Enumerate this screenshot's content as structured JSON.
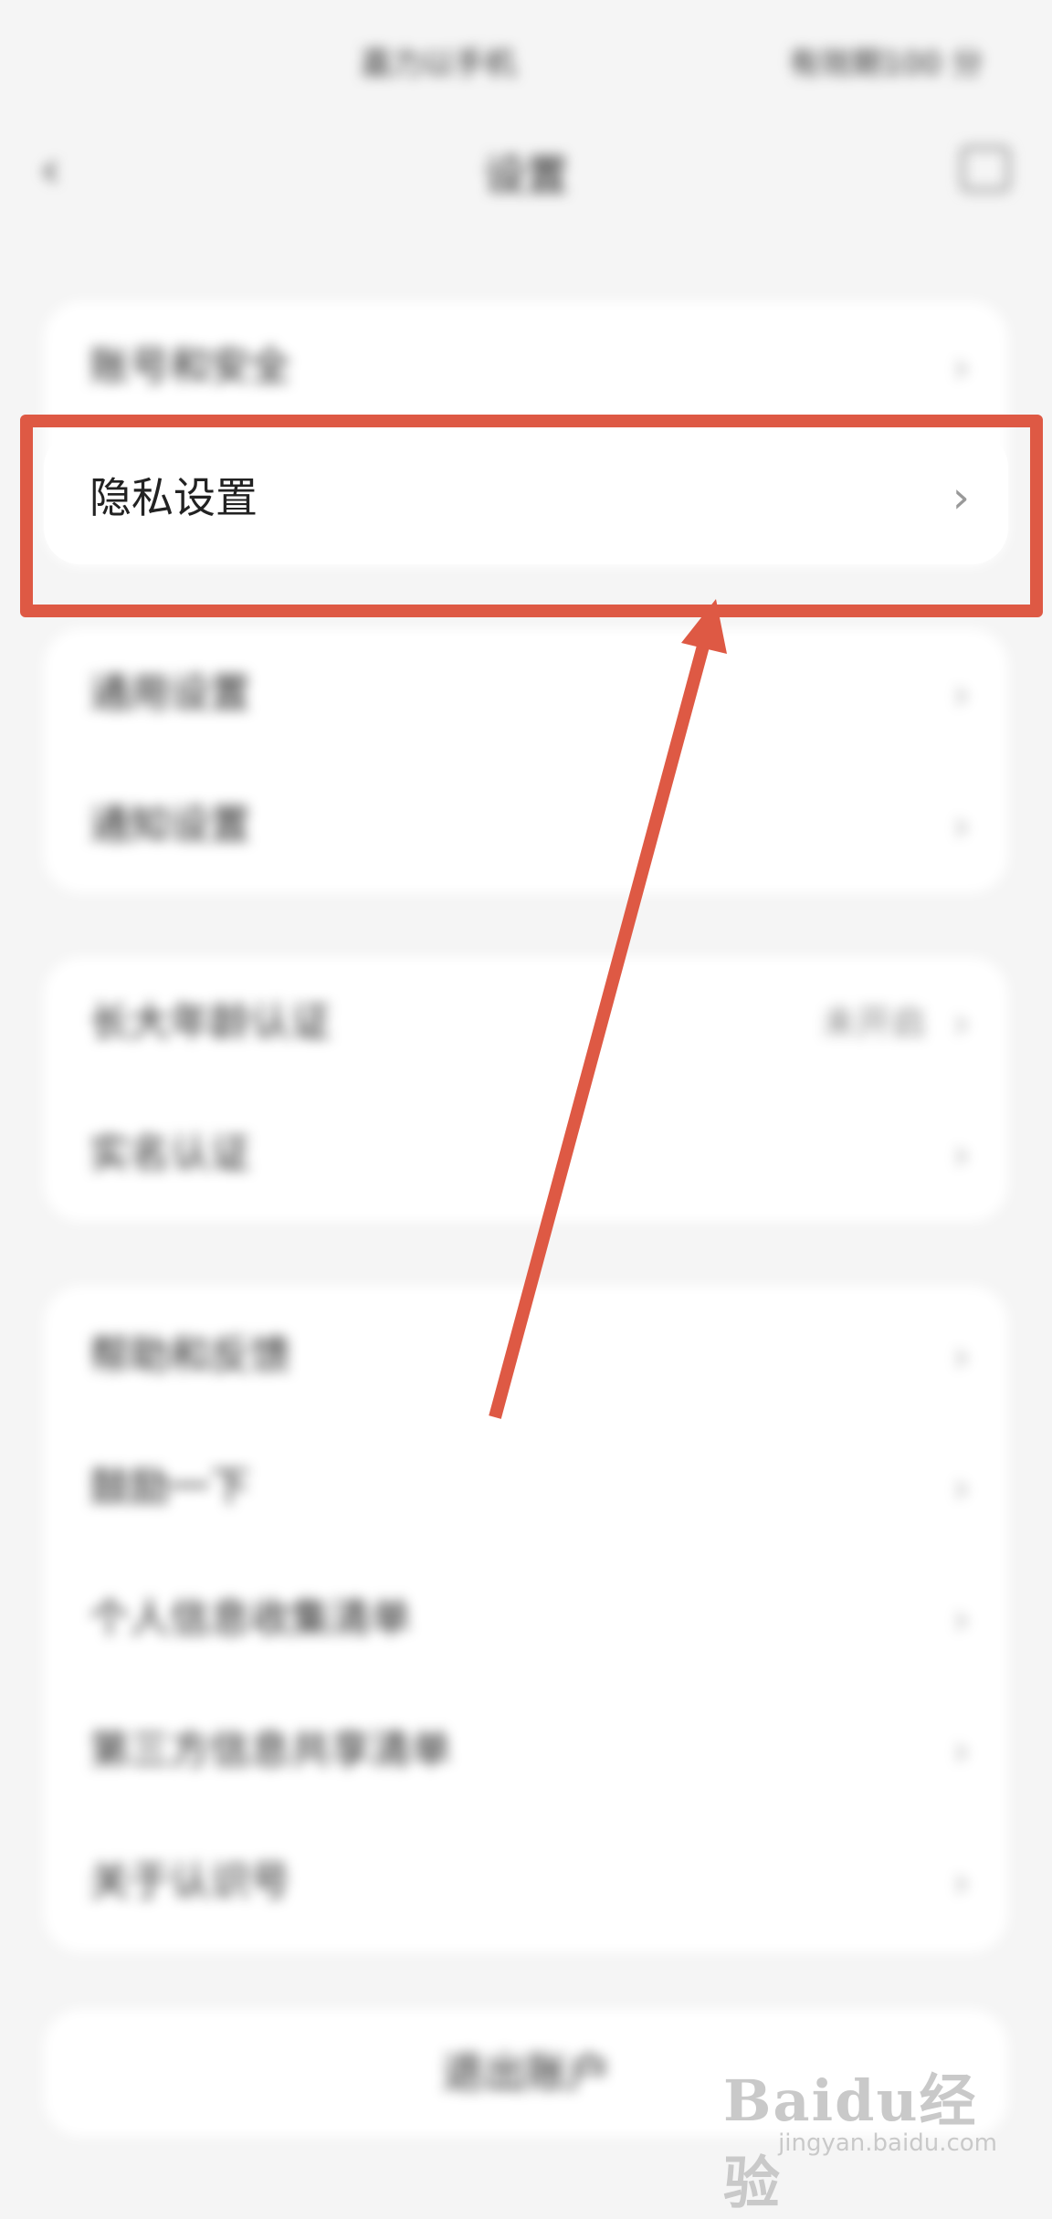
{
  "status_bar": {
    "left_text": "嘉力以手机",
    "right_text": "有效期100 分"
  },
  "nav": {
    "back_icon": "back-arrow-icon",
    "title": "设置",
    "more_icon": "scan-icon"
  },
  "groups": [
    {
      "rows": [
        {
          "label": "账号和安全"
        }
      ]
    },
    {
      "rows": [
        {
          "label": "通用设置"
        },
        {
          "label": "通知设置"
        }
      ]
    },
    {
      "rows": [
        {
          "label": "长大年龄认证",
          "value": "未开启"
        },
        {
          "label": "实名认证"
        }
      ]
    },
    {
      "rows": [
        {
          "label": "帮助和反馈"
        },
        {
          "label": "鼓励一下"
        },
        {
          "label": "个人信息收集清单"
        },
        {
          "label": "第三方信息共享清单"
        },
        {
          "label": "关于认识号"
        }
      ]
    }
  ],
  "highlighted_row": {
    "label": "隐私设置",
    "chevron": "›"
  },
  "chevron": "›",
  "logout": {
    "label": "退出账户"
  },
  "watermark": {
    "main": "Baidu经验",
    "sub": "jingyan.baidu.com"
  },
  "colors": {
    "annotation": "#de5944",
    "background": "#f5f5f5",
    "card": "#ffffff"
  }
}
